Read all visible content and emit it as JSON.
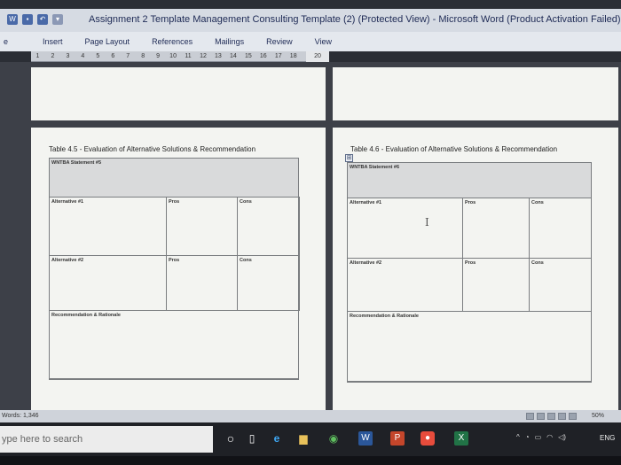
{
  "window": {
    "title": "Assignment 2 Template Management Consulting Template (2) (Protected View) - Microsoft Word (Product Activation Failed)"
  },
  "ribbon": {
    "tabs": [
      "e",
      "Insert",
      "Page Layout",
      "References",
      "Mailings",
      "Review",
      "View"
    ]
  },
  "ruler": {
    "ticks": [
      "1",
      "2",
      "3",
      "4",
      "5",
      "6",
      "7",
      "8",
      "9",
      "10",
      "11",
      "12",
      "13",
      "14",
      "15",
      "16",
      "17",
      "18"
    ],
    "extra": "20"
  },
  "left_page": {
    "caption": "Table 4.5 - Evaluation of Alternative Solutions & Recommendation",
    "statement": "WNTBA Statement #5",
    "alt1": "Alternative #1",
    "alt2": "Alternative #2",
    "pros": "Pros",
    "cons": "Cons",
    "recommendation": "Recommendation & Rationale"
  },
  "right_page": {
    "caption": "Table 4.6 - Evaluation of Alternative Solutions & Recommendation",
    "statement": "WNTBA Statement #6",
    "alt1": "Alternative #1",
    "alt2": "Alternative #2",
    "pros": "Pros",
    "cons": "Cons",
    "recommendation": "Recommendation & Rationale",
    "cursor_glyph": "I",
    "table_handle_glyph": "⊞"
  },
  "statusbar": {
    "words": "Words: 1,346",
    "zoom": "50%"
  },
  "taskbar": {
    "search_placeholder": "ype here to search",
    "language": "ENG"
  },
  "colors": {
    "title_text": "#1e2a55",
    "table_border": "#7a7d80",
    "statement_shade": "#d9dadb",
    "page_background": "#f3f4f1"
  }
}
